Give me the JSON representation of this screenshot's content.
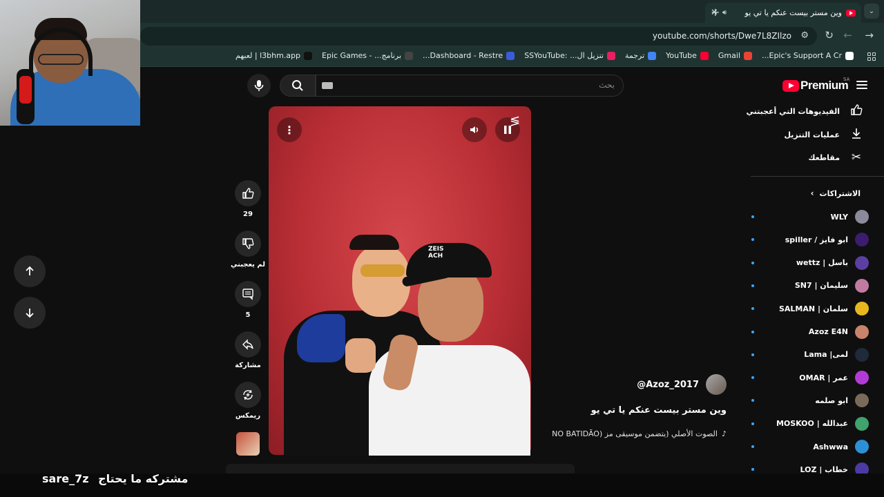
{
  "browser": {
    "tab_title": "وين مستر بيست عنكم يا تي يو",
    "url": "youtube.com/shorts/Dwe7L8ZIlzo",
    "new_tab": "+",
    "tab_close": "✕",
    "tab_list": "⌄",
    "bookmarks": [
      {
        "label": "Epic's Support A Cr...",
        "color": "#ffffff"
      },
      {
        "label": "Gmail",
        "color": "#ea4335"
      },
      {
        "label": "YouTube",
        "color": "#ff0033"
      },
      {
        "label": "ترجمة",
        "color": "#4285f4"
      },
      {
        "label": "تنزيل ال... :SSYouTube",
        "color": "#e91e63"
      },
      {
        "label": "Dashboard - Restre...",
        "color": "#3b5bdb"
      },
      {
        "label": "برنامج... - Epic Games",
        "color": "#444444"
      },
      {
        "label": "l3bhm.app | لعبهم",
        "color": "#111111"
      }
    ]
  },
  "youtube": {
    "logo_text": "Premium",
    "country_code": "SA",
    "search_placeholder": "بحث",
    "sidebar": {
      "items": [
        {
          "label": "الفيديوهات التي أعجبتني",
          "icon": "thumbs-up-icon"
        },
        {
          "label": "عمليات التنزيل",
          "icon": "download-icon"
        },
        {
          "label": "مقاطعك",
          "icon": "scissors-icon"
        }
      ],
      "subs_header": "الاشتراكات",
      "subscriptions": [
        {
          "name": "WLY",
          "color": "#8a8a9a"
        },
        {
          "name": "ابو فايز / spiller",
          "color": "#3a1d6e"
        },
        {
          "name": "باسل | wettz",
          "color": "#5b3fa3"
        },
        {
          "name": "سليمان | SN7",
          "color": "#c27ba0"
        },
        {
          "name": "سلمان | SALMAN",
          "color": "#e6b81e"
        },
        {
          "name": "Azoz E4N",
          "color": "#c9836a"
        },
        {
          "name": "لمى| Lama",
          "color": "#1f2a3a"
        },
        {
          "name": "عمر | OMAR",
          "color": "#b23bd6"
        },
        {
          "name": "ابو صلمه",
          "color": "#7a6a5a"
        },
        {
          "name": "عبدالله | MOSKOO",
          "color": "#3fa36b"
        },
        {
          "name": "Ashwwa",
          "color": "#2d8fd6"
        },
        {
          "name": "خطاب | LOZ",
          "color": "#4b3aa3"
        }
      ]
    },
    "short": {
      "channel": "@Azoz_2017",
      "title": "وين مستر بيست عنكم يا تي يو",
      "sound": "الصوت الأصلي (يتضمن موسيقى مز (NO BATIDÃO",
      "cap_text": "ZEIS\nACH",
      "actions": {
        "likes": "29",
        "dislike_label": "لم يعجبني",
        "comments": "5",
        "share_label": "مشاركة",
        "remix_label": "ريمكس"
      }
    }
  },
  "overlay": {
    "chat_user": "sare_7z",
    "chat_message": "مشتركه ما يحتاج"
  }
}
